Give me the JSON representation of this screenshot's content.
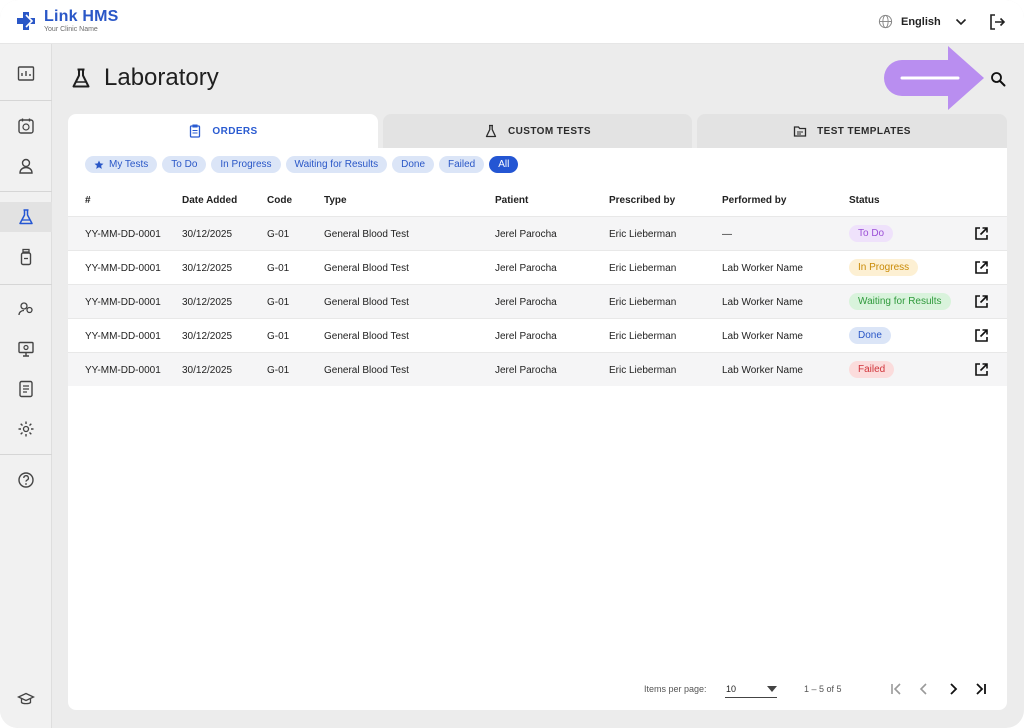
{
  "app": {
    "name": "Link HMS",
    "subtitle": "Your Clinic Name",
    "language": "English"
  },
  "colors": {
    "accent": "#2456d3",
    "brand": "#2a57c7",
    "annotation_arrow": "#b98ef0"
  },
  "page": {
    "title": "Laboratory"
  },
  "tabs": [
    {
      "label": "ORDERS",
      "icon": "clipboard-icon",
      "active": true
    },
    {
      "label": "CUSTOM TESTS",
      "icon": "flask-icon",
      "active": false
    },
    {
      "label": "TEST TEMPLATES",
      "icon": "folder-icon",
      "active": false
    }
  ],
  "filters": [
    {
      "label": "My Tests",
      "icon": "star-icon",
      "selected": false
    },
    {
      "label": "To Do",
      "selected": false
    },
    {
      "label": "In Progress",
      "selected": false
    },
    {
      "label": "Waiting for Results",
      "selected": false
    },
    {
      "label": "Done",
      "selected": false
    },
    {
      "label": "Failed",
      "selected": false
    },
    {
      "label": "All",
      "selected": true
    }
  ],
  "table": {
    "headers": [
      "#",
      "Date Added",
      "Code",
      "Type",
      "Patient",
      "Prescribed by",
      "Performed by",
      "Status"
    ],
    "rows": [
      {
        "id": "YY-MM-DD-0001",
        "date": "30/12/2025",
        "code": "G-01",
        "type": "General Blood Test",
        "patient": "Jerel Parocha",
        "prescribed": "Eric Lieberman",
        "performed": "—",
        "status": "To Do"
      },
      {
        "id": "YY-MM-DD-0001",
        "date": "30/12/2025",
        "code": "G-01",
        "type": "General Blood Test",
        "patient": "Jerel Parocha",
        "prescribed": "Eric Lieberman",
        "performed": "Lab Worker Name",
        "status": "In Progress"
      },
      {
        "id": "YY-MM-DD-0001",
        "date": "30/12/2025",
        "code": "G-01",
        "type": "General Blood Test",
        "patient": "Jerel Parocha",
        "prescribed": "Eric Lieberman",
        "performed": "Lab Worker Name",
        "status": "Waiting for Results"
      },
      {
        "id": "YY-MM-DD-0001",
        "date": "30/12/2025",
        "code": "G-01",
        "type": "General Blood Test",
        "patient": "Jerel Parocha",
        "prescribed": "Eric Lieberman",
        "performed": "Lab Worker Name",
        "status": "Done"
      },
      {
        "id": "YY-MM-DD-0001",
        "date": "30/12/2025",
        "code": "G-01",
        "type": "General Blood Test",
        "patient": "Jerel Parocha",
        "prescribed": "Eric Lieberman",
        "performed": "Lab Worker Name",
        "status": "Failed"
      }
    ]
  },
  "status_colors": {
    "To Do": {
      "bg": "#efe2fb",
      "fg": "#9b4fd6"
    },
    "In Progress": {
      "bg": "#fdf0d3",
      "fg": "#c98a06"
    },
    "Waiting for Results": {
      "bg": "#d9f3dc",
      "fg": "#2f9a3c"
    },
    "Done": {
      "bg": "#dbe5f7",
      "fg": "#2a57c7"
    },
    "Failed": {
      "bg": "#fbdcdc",
      "fg": "#d0343a"
    }
  },
  "pagination": {
    "items_label": "Items per page:",
    "per_page": "10",
    "range": "1 – 5 of 5"
  }
}
